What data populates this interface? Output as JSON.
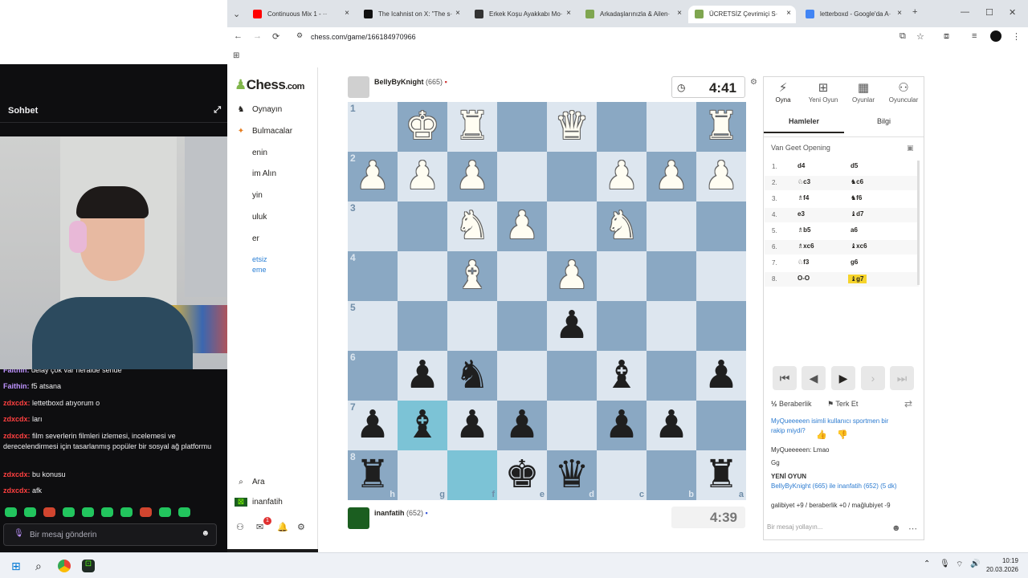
{
  "browser": {
    "tabs": [
      {
        "title": "Continuous Mix 1 - ··",
        "color": "#ff0000"
      },
      {
        "title": "The Icahnist on X: \"The s·",
        "color": "#111111"
      },
      {
        "title": "Erkek Koşu Ayakkabı Mo·",
        "color": "#333333"
      },
      {
        "title": "Arkadaşlarınızla & Ailen·",
        "color": "#7fa650"
      },
      {
        "title": "ÜCRETSİZ Çevrimiçi S·",
        "color": "#7fa650",
        "active": true
      },
      {
        "title": "letterboxd - Google'da A·",
        "color": "#4285f4"
      }
    ],
    "url": "chess.com/game/166184970966"
  },
  "stream": {
    "chat_title": "Sohbet",
    "messages": [
      {
        "user": "Faithin:",
        "text": "delay çok var heralde sende",
        "color": "#bf94ff"
      },
      {
        "user": "Faithin:",
        "text": "f5 atsana",
        "color": "#bf94ff"
      },
      {
        "user": "zdxcdx:",
        "text": "lettetboxd atıyorum o",
        "color": "#ff4040"
      },
      {
        "user": "zdxcdx:",
        "text": "ları",
        "color": "#ff4040"
      },
      {
        "user": "zdxcdx:",
        "text": "film severlerin filmleri izlemesi, incelemesi ve derecelendirmesi için tasarlanmış popüler bir sosyal ağ platformu",
        "color": "#ff4040"
      },
      {
        "user": "zdxcdx:",
        "text": "bu konusu",
        "color": "#ff4040"
      },
      {
        "user": "zdxcdx:",
        "text": "afk",
        "color": "#ff4040"
      }
    ],
    "input_placeholder": "Bir mesaj gönderin"
  },
  "site": {
    "logo_main": "Chess",
    "logo_suffix": ".com",
    "nav": [
      "Oynayın",
      "Bulmacalar",
      "enin",
      "im Alın",
      "yin",
      "uluk",
      "er",
      "etsiz",
      "eme"
    ],
    "search": "Ara",
    "user": "inanfatih",
    "notif_count": "1"
  },
  "game": {
    "top_player": {
      "name": "BellyByKnight",
      "rating": "(665)",
      "clock": "4:41"
    },
    "bottom_player": {
      "name": "inanfatih",
      "rating": "(652)",
      "clock": "4:39"
    },
    "board": [
      [
        "",
        "wK",
        "wR",
        "",
        "wQ",
        "",
        "",
        "wR"
      ],
      [
        "wP",
        "wP",
        "wP",
        "",
        "",
        "wP",
        "wP",
        "wP"
      ],
      [
        "",
        "",
        "wN",
        "wP",
        "",
        "wN",
        "",
        ""
      ],
      [
        "",
        "",
        "wB",
        "",
        "wP",
        "",
        "",
        ""
      ],
      [
        "",
        "",
        "",
        "",
        "bP",
        "",
        "",
        ""
      ],
      [
        "",
        "bP",
        "bN",
        "",
        "",
        "bB",
        "",
        "bP"
      ],
      [
        "bP",
        "bB",
        "bP",
        "bP",
        "",
        "bP",
        "bP",
        ""
      ],
      [
        "bR",
        "",
        "",
        "bK",
        "bQ",
        "",
        "",
        "bR"
      ]
    ],
    "ranks": [
      "1",
      "2",
      "3",
      "4",
      "5",
      "6",
      "7",
      "8"
    ],
    "files": [
      "h",
      "g",
      "f",
      "e",
      "d",
      "c",
      "b",
      "a"
    ]
  },
  "panel": {
    "top_tabs": [
      "Oyna",
      "Yeni Oyun",
      "Oyunlar",
      "Oyuncular"
    ],
    "sub_tabs": [
      "Hamleler",
      "Bilgi"
    ],
    "opening": "Van Geet Opening",
    "moves": [
      {
        "n": "1.",
        "w": "d4",
        "b": "d5"
      },
      {
        "n": "2.",
        "w": "♘c3",
        "b": "♞c6"
      },
      {
        "n": "3.",
        "w": "♗f4",
        "b": "♞f6"
      },
      {
        "n": "4.",
        "w": "e3",
        "b": "♝d7"
      },
      {
        "n": "5.",
        "w": "♗b5",
        "b": "a6"
      },
      {
        "n": "6.",
        "w": "♗xc6",
        "b": "♝xc6"
      },
      {
        "n": "7.",
        "w": "♘f3",
        "b": "g6"
      },
      {
        "n": "8.",
        "w": "O-O",
        "b": "♝g7"
      }
    ],
    "draw": "Beraberlik",
    "resign": "Terk Et",
    "chat": [
      "MyQueeeeen isimli kullanıcı sportmen bir rakip miydi?",
      "MyQueeeeen: Lmao",
      "Gg",
      "YENİ OYUN",
      "BellyByKnight (665) ile inanfatih (652) (5 dk)",
      "galibiyet +9 / beraberlik +0 / mağlubiyet -9"
    ],
    "message_placeholder": "Bir mesaj yollayın..."
  },
  "taskbar": {
    "time": "10:19",
    "date": "20.03.2026"
  }
}
